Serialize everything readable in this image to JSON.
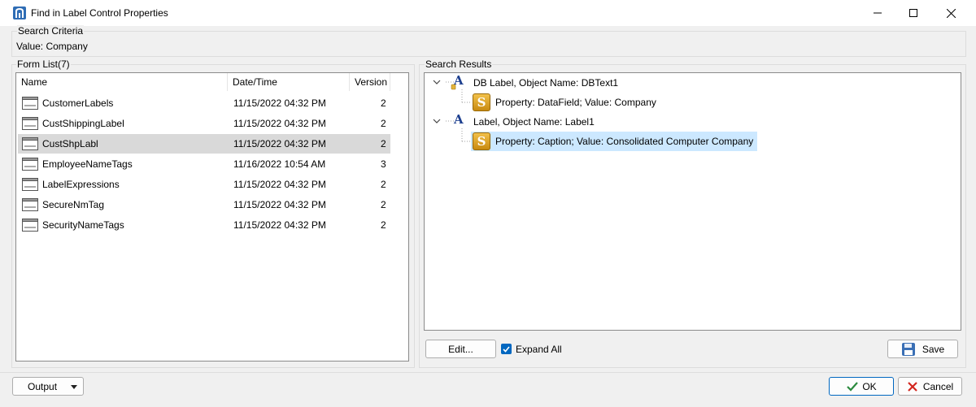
{
  "window": {
    "title": "Find in Label Control Properties"
  },
  "search_criteria": {
    "title": "Search Criteria",
    "value_text": "Value: Company"
  },
  "form_list": {
    "title": "Form List(7)",
    "columns": [
      "Name",
      "Date/Time",
      "Version"
    ],
    "rows": [
      {
        "name": "CustomerLabels",
        "datetime": "11/15/2022 04:32 PM",
        "version": "2"
      },
      {
        "name": "CustShippingLabel",
        "datetime": "11/15/2022 04:32 PM",
        "version": "2"
      },
      {
        "name": "CustShpLabl",
        "datetime": "11/15/2022 04:32 PM",
        "version": "2",
        "selected": true
      },
      {
        "name": "EmployeeNameTags",
        "datetime": "11/16/2022 10:54 AM",
        "version": "3"
      },
      {
        "name": "LabelExpressions",
        "datetime": "11/15/2022 04:32 PM",
        "version": "2"
      },
      {
        "name": "SecureNmTag",
        "datetime": "11/15/2022 04:32 PM",
        "version": "2"
      },
      {
        "name": "SecurityNameTags",
        "datetime": "11/15/2022 04:32 PM",
        "version": "2"
      }
    ]
  },
  "search_results": {
    "title": "Search Results",
    "nodes": [
      {
        "label": "DB Label, Object Name: DBText1",
        "icon": "db-label-icon",
        "children": [
          {
            "label": "Property: DataField; Value: Company",
            "icon": "property-s-icon"
          }
        ]
      },
      {
        "label": "Label, Object Name: Label1",
        "icon": "label-icon",
        "children": [
          {
            "label": "Property: Caption; Value: Consolidated Computer Company",
            "icon": "property-s-icon",
            "selected": true
          }
        ]
      }
    ]
  },
  "actions": {
    "edit_label": "Edit...",
    "expand_all_label": "Expand All",
    "expand_all_checked": true,
    "save_label": "Save"
  },
  "footer": {
    "output_label": "Output",
    "ok_label": "OK",
    "cancel_label": "Cancel"
  },
  "colors": {
    "selection": "#cce8ff",
    "row_selected": "#d9d9d9",
    "accent": "#0067c0",
    "ok_border": "#2b8a3e"
  }
}
